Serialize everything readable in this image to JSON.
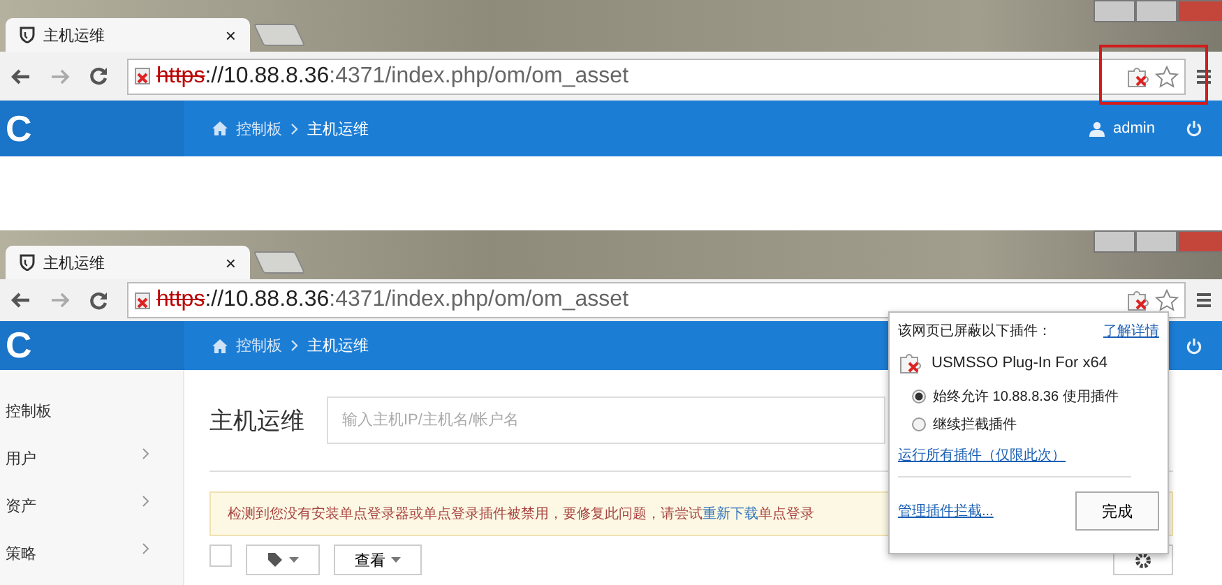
{
  "top_capture": {
    "tab": {
      "title": "主机运维",
      "close": "×"
    },
    "url": {
      "scheme": "https",
      "host": "://10.88.8.36",
      "path": ":4371/index.php/om/om_asset"
    },
    "logo": "C",
    "breadcrumb": [
      "控制板",
      "主机运维"
    ],
    "user": "admin",
    "highlight_plugin_icon": true
  },
  "bottom_capture": {
    "tab": {
      "title": "主机运维",
      "close": "×"
    },
    "url": {
      "scheme": "https",
      "host": "://10.88.8.36",
      "path": ":4371/index.php/om/om_asset"
    },
    "logo": "C",
    "breadcrumb": [
      "控制板",
      "主机运维"
    ],
    "sidebar": [
      {
        "label": "控制板",
        "has_arrow": false
      },
      {
        "label": "用户",
        "has_arrow": true
      },
      {
        "label": "资产",
        "has_arrow": true
      },
      {
        "label": "策略",
        "has_arrow": true
      }
    ],
    "page_title": "主机运维",
    "search": {
      "placeholder": "输入主机IP/主机名/帐户名"
    },
    "warning": {
      "before": "检测到您没有安装单点登录器或单点登录插件被禁用，要修复此问题，请尝试",
      "link": "重新下载",
      "after": "单点登录"
    },
    "toolbar": {
      "select_all_checked": false,
      "view_button": "查看"
    },
    "popup": {
      "heading": "该网页已屏蔽以下插件：",
      "learn_more": "了解详情",
      "plugin": "USMSSO Plug-In For x64",
      "options": [
        {
          "label": "始终允许 10.88.8.36 使用插件",
          "selected": true
        },
        {
          "label": "继续拦截插件",
          "selected": false
        }
      ],
      "run_all": "运行所有插件（仅限此次）",
      "manage": "管理插件拦截...",
      "done": "完成"
    }
  }
}
